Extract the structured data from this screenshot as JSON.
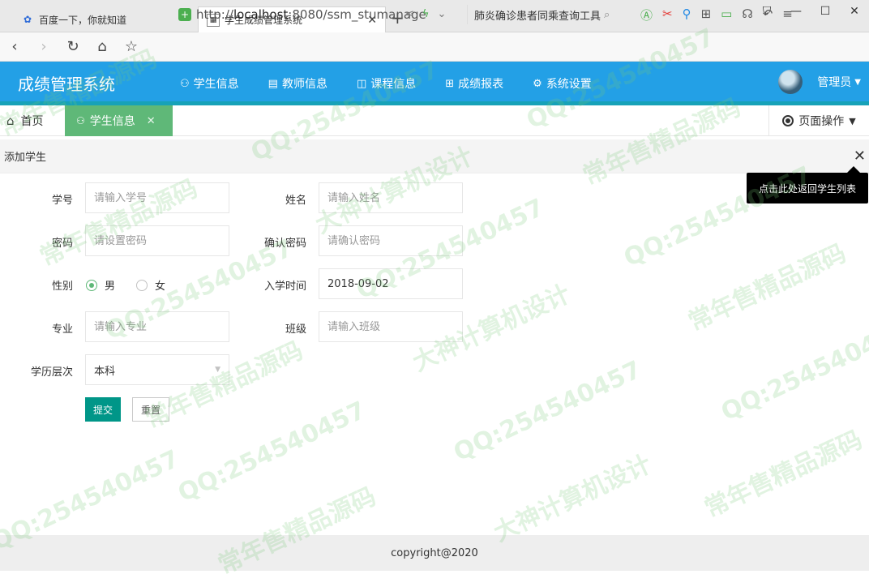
{
  "browser": {
    "tabs": [
      {
        "title": "百度一下，你就知道",
        "icon": "baidu-paw-icon",
        "active": false
      },
      {
        "title": "学生成绩管理系统",
        "icon": "page-favicon-icon",
        "active": true
      }
    ],
    "address": {
      "scheme": "http://",
      "host": "localhost",
      "rest": ":8080/ssm_stumanage"
    },
    "search_text": "肺炎确诊患者同乘查询工具"
  },
  "app": {
    "title": "成绩管理系统",
    "nav": [
      {
        "label": "学生信息",
        "icon": "users-icon",
        "active": true
      },
      {
        "label": "教师信息",
        "icon": "document-icon",
        "active": false
      },
      {
        "label": "课程信息",
        "icon": "book-icon",
        "active": false
      },
      {
        "label": "成绩报表",
        "icon": "table-icon",
        "active": false
      },
      {
        "label": "系统设置",
        "icon": "gear-icon",
        "active": false
      }
    ],
    "user": {
      "name": "管理员"
    }
  },
  "page_tabs": {
    "home": "首页",
    "current": "学生信息",
    "ops": "页面操作"
  },
  "panel": {
    "title": "添加学生",
    "close_tooltip": "点击此处返回学生列表"
  },
  "form": {
    "student_no": {
      "label": "学号",
      "placeholder": "请输入学号"
    },
    "name": {
      "label": "姓名",
      "placeholder": "请输入姓名"
    },
    "password": {
      "label": "密码",
      "placeholder": "请设置密码"
    },
    "confirm_password": {
      "label": "确认密码",
      "placeholder": "请确认密码"
    },
    "gender": {
      "label": "性别",
      "options": [
        "男",
        "女"
      ],
      "selected": "男"
    },
    "enroll_date": {
      "label": "入学时间",
      "value": "2018-09-02"
    },
    "major": {
      "label": "专业",
      "placeholder": "请输入专业"
    },
    "class": {
      "label": "班级",
      "placeholder": "请输入班级"
    },
    "education": {
      "label": "学历层次",
      "value": "本科"
    },
    "submit_label": "提交",
    "reset_label": "重置"
  },
  "footer": {
    "text": "copyright@2020"
  },
  "watermarks": [
    "QQ:254540457",
    "大神计算机设计",
    "常年售精品源码"
  ],
  "colors": {
    "header": "#23a0e6",
    "active_tab": "#5fb878",
    "primary_button": "#009688"
  }
}
